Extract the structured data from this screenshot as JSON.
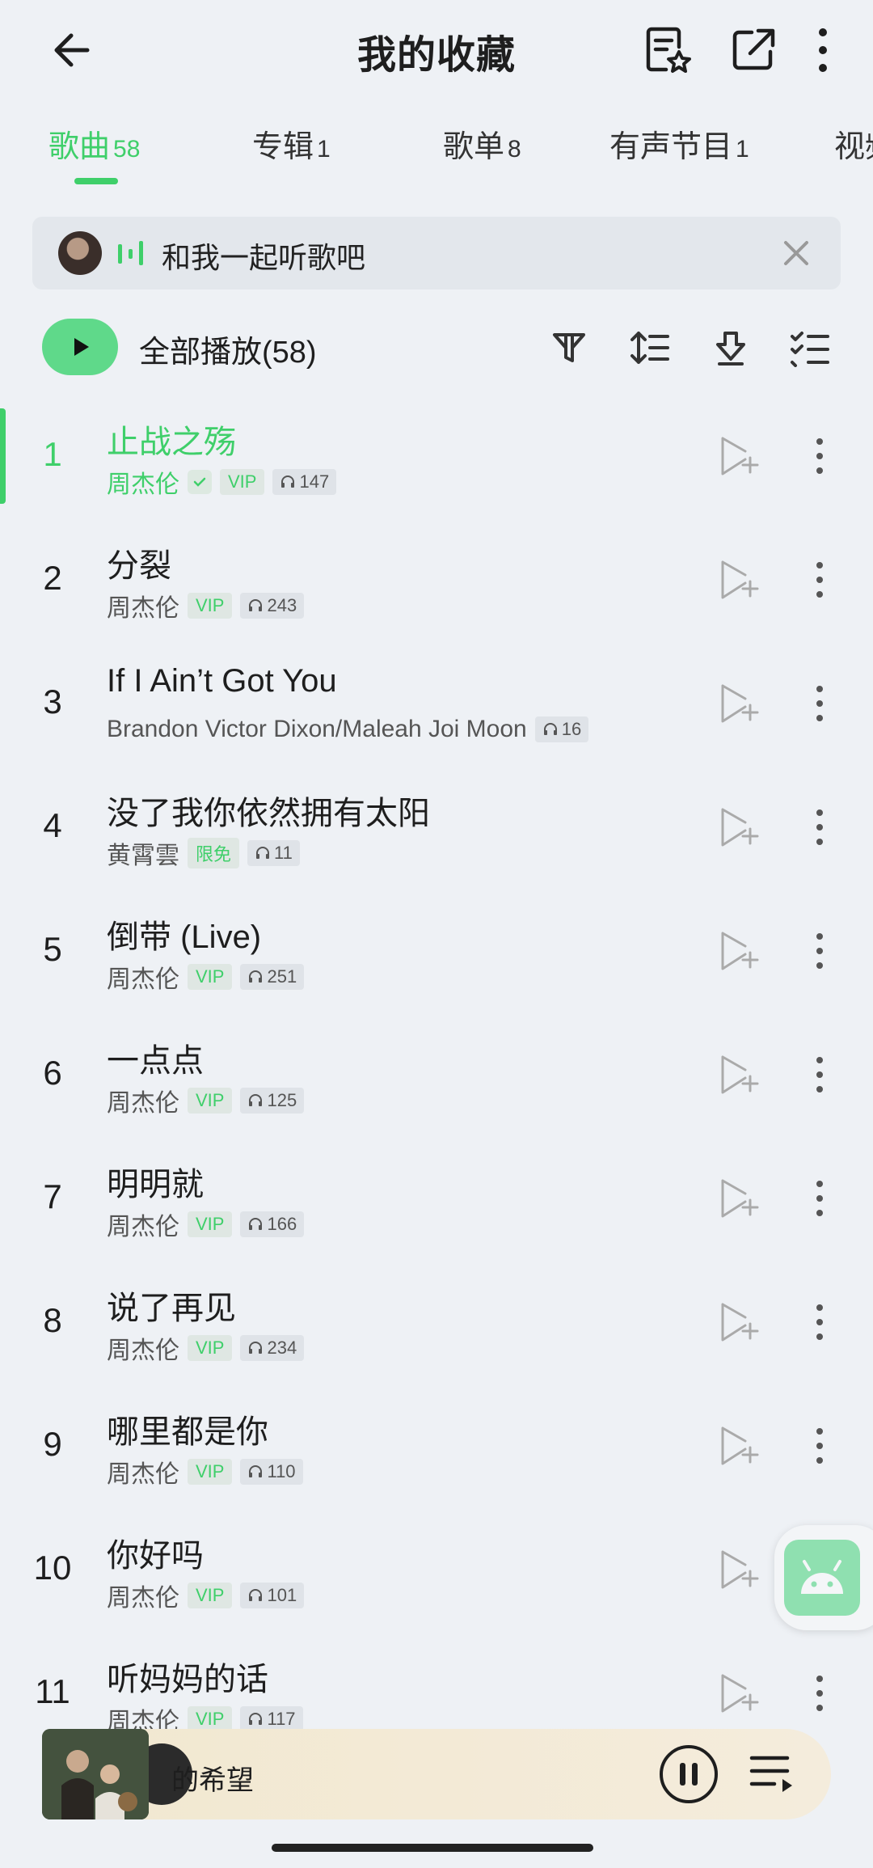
{
  "header": {
    "title": "我的收藏"
  },
  "tabs": [
    {
      "label": "歌曲",
      "count": "58",
      "active": true
    },
    {
      "label": "专辑",
      "count": "1"
    },
    {
      "label": "歌单",
      "count": "8"
    },
    {
      "label": "有声节目",
      "count": "1"
    },
    {
      "label": "视频",
      "count": ""
    }
  ],
  "listen_together": {
    "text": "和我一起听歌吧"
  },
  "controls": {
    "play_all_label": "全部播放(58)"
  },
  "songs": [
    {
      "index": "1",
      "title": "止战之殇",
      "artist": "周杰伦",
      "verified": true,
      "badge": "VIP",
      "plays": "147",
      "active": true
    },
    {
      "index": "2",
      "title": "分裂",
      "artist": "周杰伦",
      "badge": "VIP",
      "plays": "243"
    },
    {
      "index": "3",
      "title": "If I Ain’t Got You",
      "artist": "Brandon Victor Dixon/Maleah Joi Moon",
      "badge": "",
      "plays": "16"
    },
    {
      "index": "4",
      "title": "没了我你依然拥有太阳",
      "artist": "黄霄雲",
      "badge": "限免",
      "plays": "11"
    },
    {
      "index": "5",
      "title": "倒带 (Live)",
      "artist": "周杰伦",
      "badge": "VIP",
      "plays": "251"
    },
    {
      "index": "6",
      "title": "一点点",
      "artist": "周杰伦",
      "badge": "VIP",
      "plays": "125"
    },
    {
      "index": "7",
      "title": "明明就",
      "artist": "周杰伦",
      "badge": "VIP",
      "plays": "166"
    },
    {
      "index": "8",
      "title": "说了再见",
      "artist": "周杰伦",
      "badge": "VIP",
      "plays": "234"
    },
    {
      "index": "9",
      "title": "哪里都是你",
      "artist": "周杰伦",
      "badge": "VIP",
      "plays": "110"
    },
    {
      "index": "10",
      "title": "你好吗",
      "artist": "周杰伦",
      "badge": "VIP",
      "plays": "101"
    },
    {
      "index": "11",
      "title": "听妈妈的话",
      "artist": "周杰伦",
      "badge": "VIP",
      "plays": "117"
    }
  ],
  "player": {
    "title": "的希望"
  },
  "colors": {
    "accent": "#3fcf6a",
    "background": "#eef1f5",
    "player_bg": "#f2e8d0"
  }
}
